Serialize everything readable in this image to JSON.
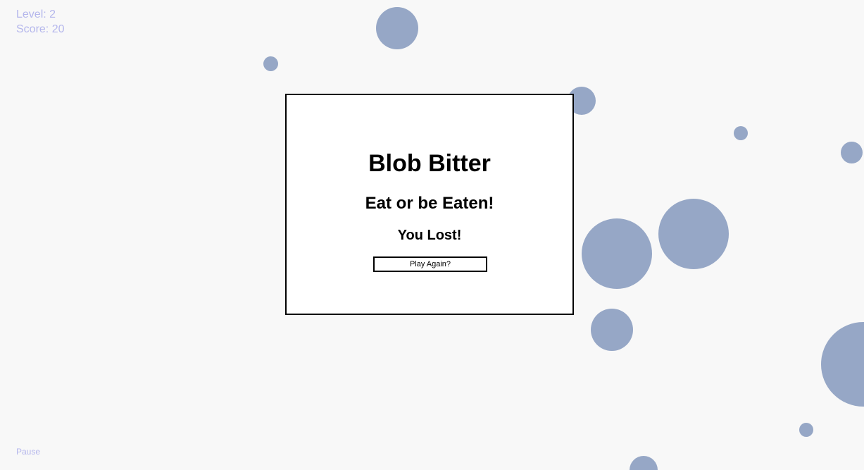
{
  "hud": {
    "level": "Level: 2",
    "score": "Score: 20",
    "pause_label": "Pause"
  },
  "dialog": {
    "title": "Blob Bitter",
    "tagline": "Eat or be Eaten!",
    "result": "You Lost!",
    "play_again_label": "Play Again?"
  },
  "colors": {
    "background": "#f8f8f8",
    "blob": "#96a7c6",
    "hud_text": "#b4b6ec"
  }
}
